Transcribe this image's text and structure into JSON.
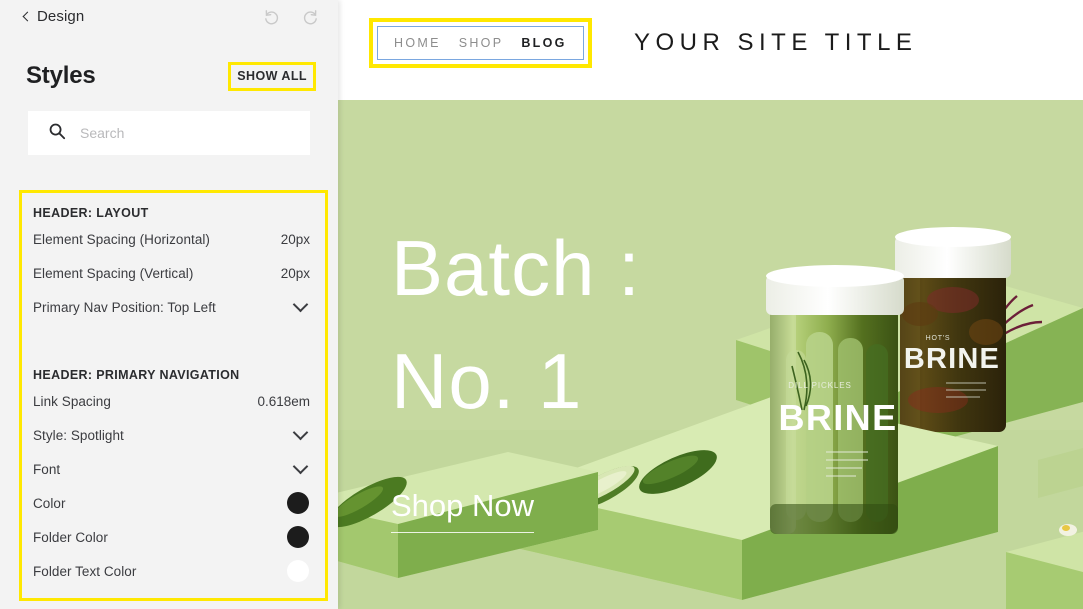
{
  "panel": {
    "back_label": "Design",
    "undo_icon": "undo-icon",
    "redo_icon": "redo-icon",
    "title": "Styles",
    "show_all_label": "SHOW ALL",
    "search": {
      "icon": "search-icon",
      "value": "",
      "placeholder": "Search"
    },
    "groups": [
      {
        "heading": "HEADER: LAYOUT",
        "rows": [
          {
            "label": "Element Spacing (Horizontal)",
            "value": "20px",
            "control": "value"
          },
          {
            "label": "Element Spacing (Vertical)",
            "value": "20px",
            "control": "value"
          },
          {
            "label": "Primary Nav Position: Top Left",
            "value": "",
            "control": "chevron-down"
          }
        ]
      },
      {
        "heading": "HEADER: PRIMARY NAVIGATION",
        "rows": [
          {
            "label": "Link Spacing",
            "value": "0.618em",
            "control": "value"
          },
          {
            "label": "Style: Spotlight",
            "value": "",
            "control": "chevron-down"
          },
          {
            "label": "Font",
            "value": "",
            "control": "chevron-down"
          },
          {
            "label": "Color",
            "value": "",
            "control": "swatch",
            "color": "#1c1c1c"
          },
          {
            "label": "Folder Color",
            "value": "",
            "control": "swatch",
            "color": "#1c1c1c"
          },
          {
            "label": "Folder Text Color",
            "value": "",
            "control": "swatch",
            "color": "#ffffff"
          }
        ]
      }
    ]
  },
  "preview": {
    "nav": {
      "links": [
        {
          "label": "HOME",
          "active": false
        },
        {
          "label": "SHOP",
          "active": false
        },
        {
          "label": "BLOG",
          "active": true
        }
      ]
    },
    "site_title": "YOUR SITE TITLE",
    "hero": {
      "headline_lines": [
        "Batch :",
        "No. 1"
      ],
      "cta_label": "Shop Now",
      "background_color": "#c6d9a0",
      "image_alt": "pickle-jars-on-green-pedestals"
    }
  },
  "highlight_color": "#ffe800",
  "selection_color": "#7aa7e0"
}
